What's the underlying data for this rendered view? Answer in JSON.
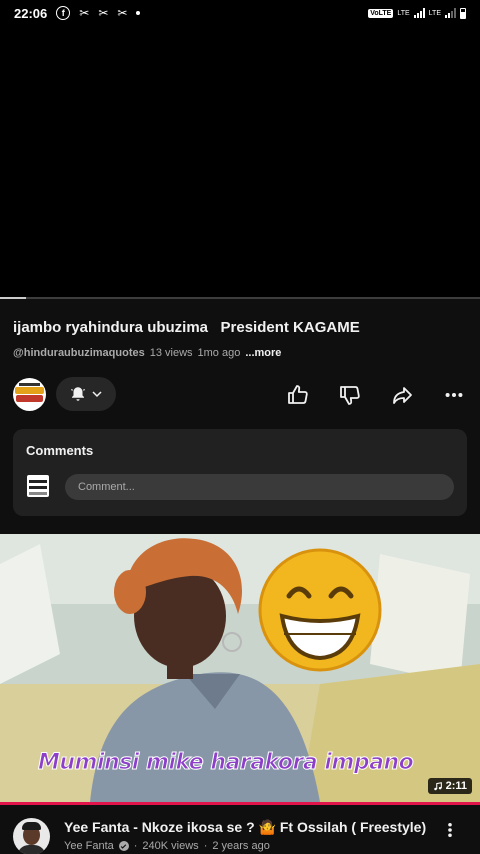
{
  "status_bar": {
    "time": "22:06",
    "network_badge": "VoLTE",
    "lte_1": "LTE",
    "lte_2": "LTE"
  },
  "player": {
    "progress_fraction": 0.055
  },
  "video": {
    "title": "ijambo ryahindura ubuzima   President KAGAME",
    "channel_handle": "@hinduraubuzimaquotes",
    "views": "13 views",
    "age": "1mo ago",
    "more_label": "...more"
  },
  "actions": {
    "channel_avatar_icon": "channel-logo",
    "bell_icon": "bell-icon",
    "like_icon": "thumbs-up-icon",
    "dislike_icon": "thumbs-down-icon",
    "share_icon": "share-icon",
    "more_icon": "more-horizontal-icon"
  },
  "comments": {
    "title": "Comments",
    "placeholder": "Comment..."
  },
  "recommendation": {
    "caption": "Muminsi mike harakora impano",
    "duration": "2:11",
    "title": "Yee Fanta - Nkoze ikosa se ? 🤷 Ft Ossilah ( Freestyle)",
    "channel": "Yee Fanta",
    "views": "240K views",
    "age": "2 years ago",
    "separator": "·"
  },
  "colors": {
    "background": "#0f0f0f",
    "card": "#212121",
    "chip": "#272727",
    "accent_red": "#e1154c",
    "caption_fill": "#8e3fc9",
    "text_primary": "#f1f1f1",
    "text_secondary": "#aaaaaa"
  }
}
